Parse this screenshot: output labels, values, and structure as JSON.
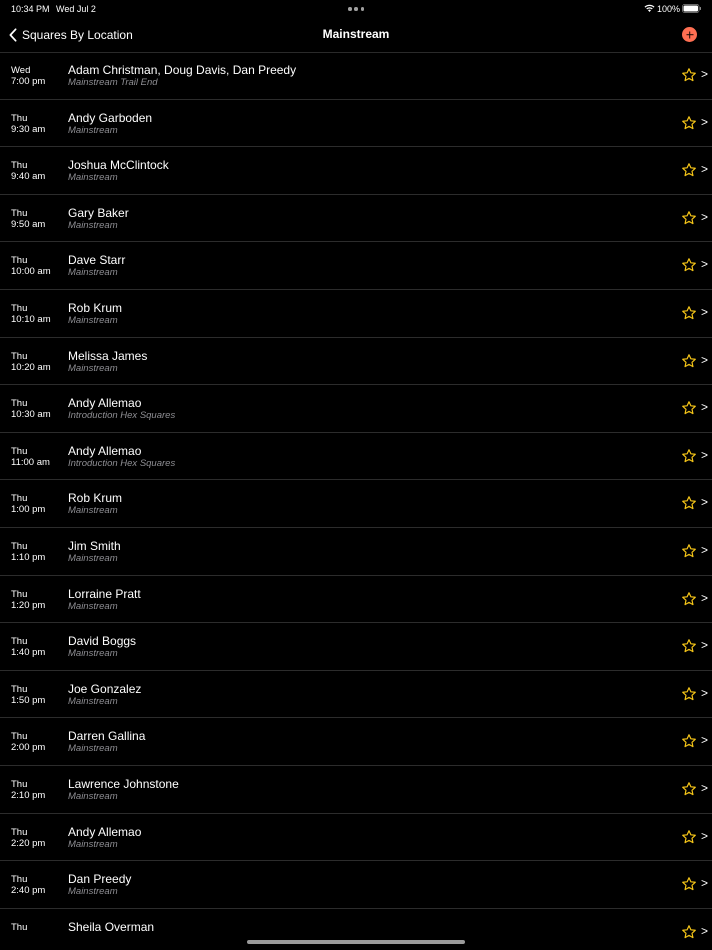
{
  "status_bar": {
    "time": "10:34 PM",
    "date": "Wed Jul 2",
    "battery": "100%",
    "wifi_icon": "wifi-icon",
    "battery_icon": "battery-full-icon"
  },
  "nav": {
    "back_label": "Squares By Location",
    "title": "Mainstream",
    "add_icon": "plus-circle-icon",
    "accent_color": "#ff6f52"
  },
  "star_color": "#f5c518",
  "sessions": [
    {
      "day": "Wed",
      "time": "7:00 pm",
      "caller": "Adam Christman, Doug Davis, Dan Preedy",
      "program": "Mainstream Trail End"
    },
    {
      "day": "Thu",
      "time": "9:30 am",
      "caller": "Andy Garboden",
      "program": "Mainstream"
    },
    {
      "day": "Thu",
      "time": "9:40 am",
      "caller": "Joshua McClintock",
      "program": "Mainstream"
    },
    {
      "day": "Thu",
      "time": "9:50 am",
      "caller": "Gary Baker",
      "program": "Mainstream"
    },
    {
      "day": "Thu",
      "time": "10:00 am",
      "caller": "Dave Starr",
      "program": "Mainstream"
    },
    {
      "day": "Thu",
      "time": "10:10 am",
      "caller": "Rob Krum",
      "program": "Mainstream"
    },
    {
      "day": "Thu",
      "time": "10:20 am",
      "caller": "Melissa James",
      "program": "Mainstream"
    },
    {
      "day": "Thu",
      "time": "10:30 am",
      "caller": "Andy Allemao",
      "program": "Introduction Hex Squares"
    },
    {
      "day": "Thu",
      "time": "11:00 am",
      "caller": "Andy Allemao",
      "program": "Introduction Hex Squares"
    },
    {
      "day": "Thu",
      "time": "1:00 pm",
      "caller": "Rob Krum",
      "program": "Mainstream"
    },
    {
      "day": "Thu",
      "time": "1:10 pm",
      "caller": "Jim Smith",
      "program": "Mainstream"
    },
    {
      "day": "Thu",
      "time": "1:20 pm",
      "caller": "Lorraine Pratt",
      "program": "Mainstream"
    },
    {
      "day": "Thu",
      "time": "1:40 pm",
      "caller": "David Boggs",
      "program": "Mainstream"
    },
    {
      "day": "Thu",
      "time": "1:50 pm",
      "caller": "Joe Gonzalez",
      "program": "Mainstream"
    },
    {
      "day": "Thu",
      "time": "2:00 pm",
      "caller": "Darren Gallina",
      "program": "Mainstream"
    },
    {
      "day": "Thu",
      "time": "2:10 pm",
      "caller": "Lawrence Johnstone",
      "program": "Mainstream"
    },
    {
      "day": "Thu",
      "time": "2:20 pm",
      "caller": "Andy Allemao",
      "program": "Mainstream"
    },
    {
      "day": "Thu",
      "time": "2:40 pm",
      "caller": "Dan Preedy",
      "program": "Mainstream"
    },
    {
      "day": "Thu",
      "time": "",
      "caller": "Sheila Overman",
      "program": ""
    }
  ],
  "row_chevron": ">"
}
